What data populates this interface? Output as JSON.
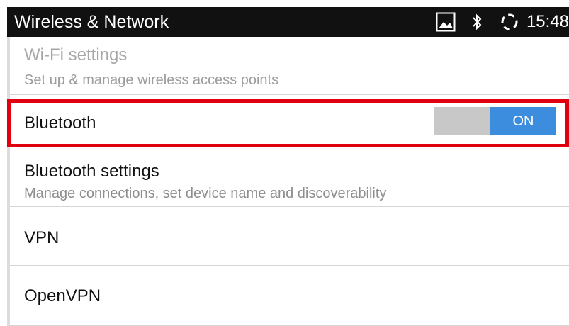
{
  "statusbar": {
    "title": "Wireless & Network",
    "time": "15:48",
    "icons": [
      "picture-icon",
      "bluetooth-icon",
      "sync-icon"
    ]
  },
  "settings": {
    "wifi": {
      "title": "Wi-Fi settings",
      "subtitle": "Set up & manage wireless access points",
      "enabled": false
    },
    "bluetooth": {
      "title": "Bluetooth",
      "toggle_label": "ON",
      "toggle_on": true
    },
    "bluetooth_settings": {
      "title": "Bluetooth settings",
      "subtitle": "Manage connections, set device name and discoverability"
    },
    "vpn": {
      "title": "VPN"
    },
    "openvpn": {
      "title": "OpenVPN"
    }
  },
  "colors": {
    "highlight": "#e0000f",
    "toggle_on": "#3d8ddf",
    "toggle_off": "#c8c8c8",
    "statusbar": "#111111"
  }
}
